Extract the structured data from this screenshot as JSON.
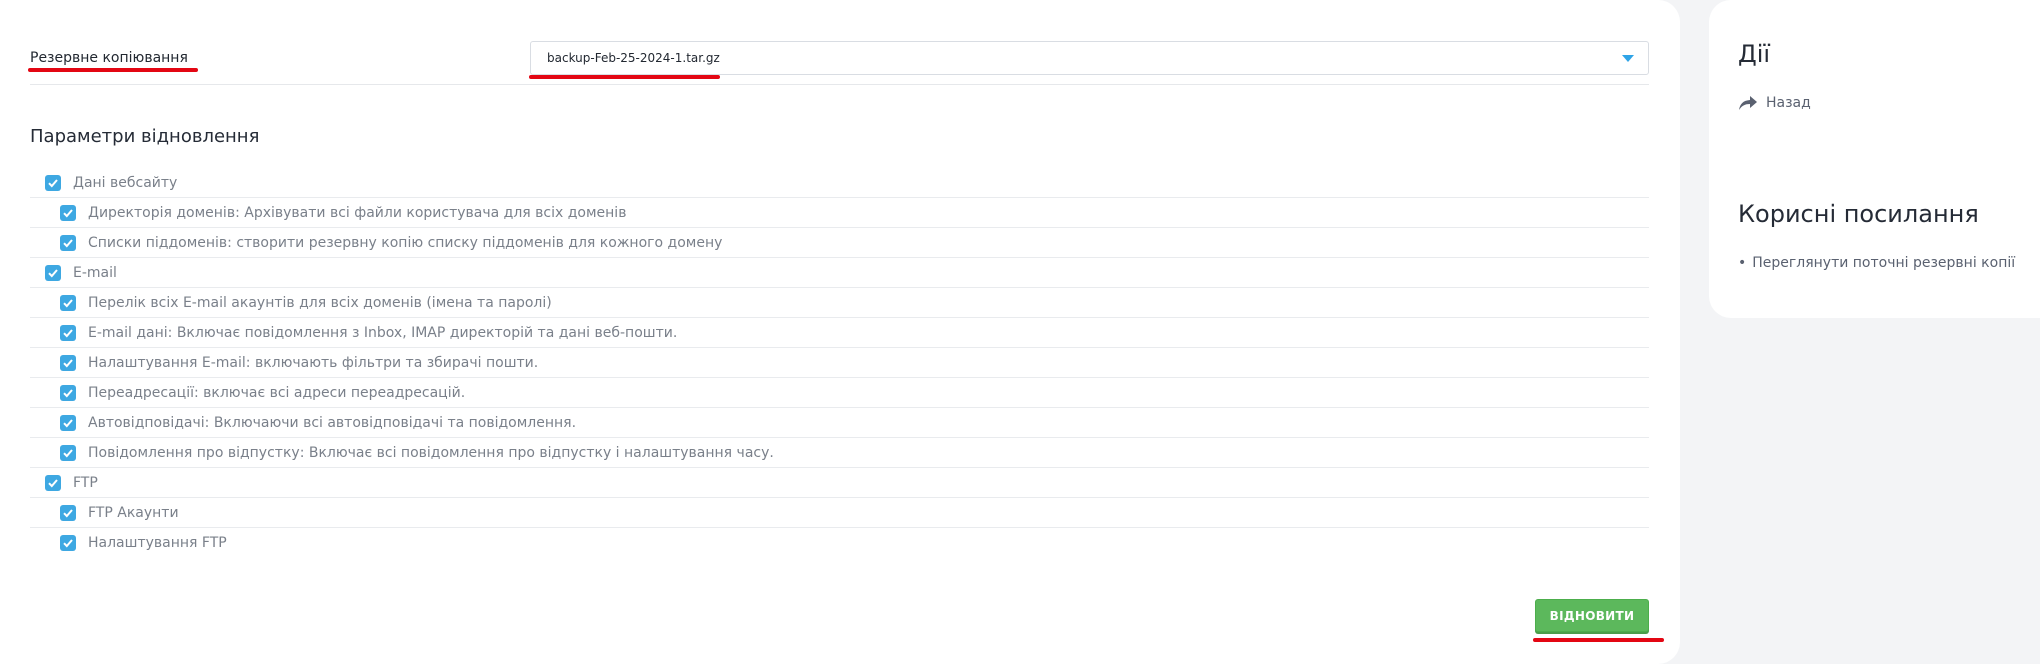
{
  "backup": {
    "label": "Резервне копіювання",
    "selected_file": "backup-Feb-25-2024-1.tar.gz"
  },
  "restore_options": {
    "title": "Параметри відновлення",
    "items": [
      {
        "label": "Дані вебсайту",
        "checked": true
      },
      {
        "label": "Директорія доменів: Архівувати всі файли користувача для всіх доменів",
        "checked": true
      },
      {
        "label": "Списки піддоменів: створити резервну копію списку піддоменів для кожного домену",
        "checked": true
      },
      {
        "label": "E-mail",
        "checked": true
      },
      {
        "label": "Перелік всіх E-mail акаунтів для всіх доменів (імена та паролі)",
        "checked": true
      },
      {
        "label": "E-mail дані: Включає повідомлення з Inbox, IMAP директорій та дані веб-пошти.",
        "checked": true
      },
      {
        "label": "Налаштування E-mail: включають фільтри та збирачі пошти.",
        "checked": true
      },
      {
        "label": "Переадресації: включає всі адреси переадресацій.",
        "checked": true
      },
      {
        "label": "Автовідповідачі: Включаючи всі автовідповідачі та повідомлення.",
        "checked": true
      },
      {
        "label": "Повідомлення про відпустку: Включає всі повідомлення про відпустку і налаштування часу.",
        "checked": true
      },
      {
        "label": "FTP",
        "checked": true
      },
      {
        "label": "FTP Акаунти",
        "checked": true
      },
      {
        "label": "Налаштування FTP",
        "checked": true
      }
    ]
  },
  "restore_button": {
    "label": "ВІДНОВИТИ"
  },
  "sidebar": {
    "actions_title": "Дії",
    "back_label": "Назад",
    "links_title": "Корисні посилання",
    "bullet": "•",
    "view_backups_label": "Переглянути поточні резервні копії"
  },
  "colors": {
    "accent": "#3ea8e2",
    "button": "#5cb85c",
    "highlight": "#e30613"
  },
  "icons": {
    "dropdown": "chevron-down-icon",
    "checkbox": "check-icon",
    "back": "share-arrow-icon"
  }
}
